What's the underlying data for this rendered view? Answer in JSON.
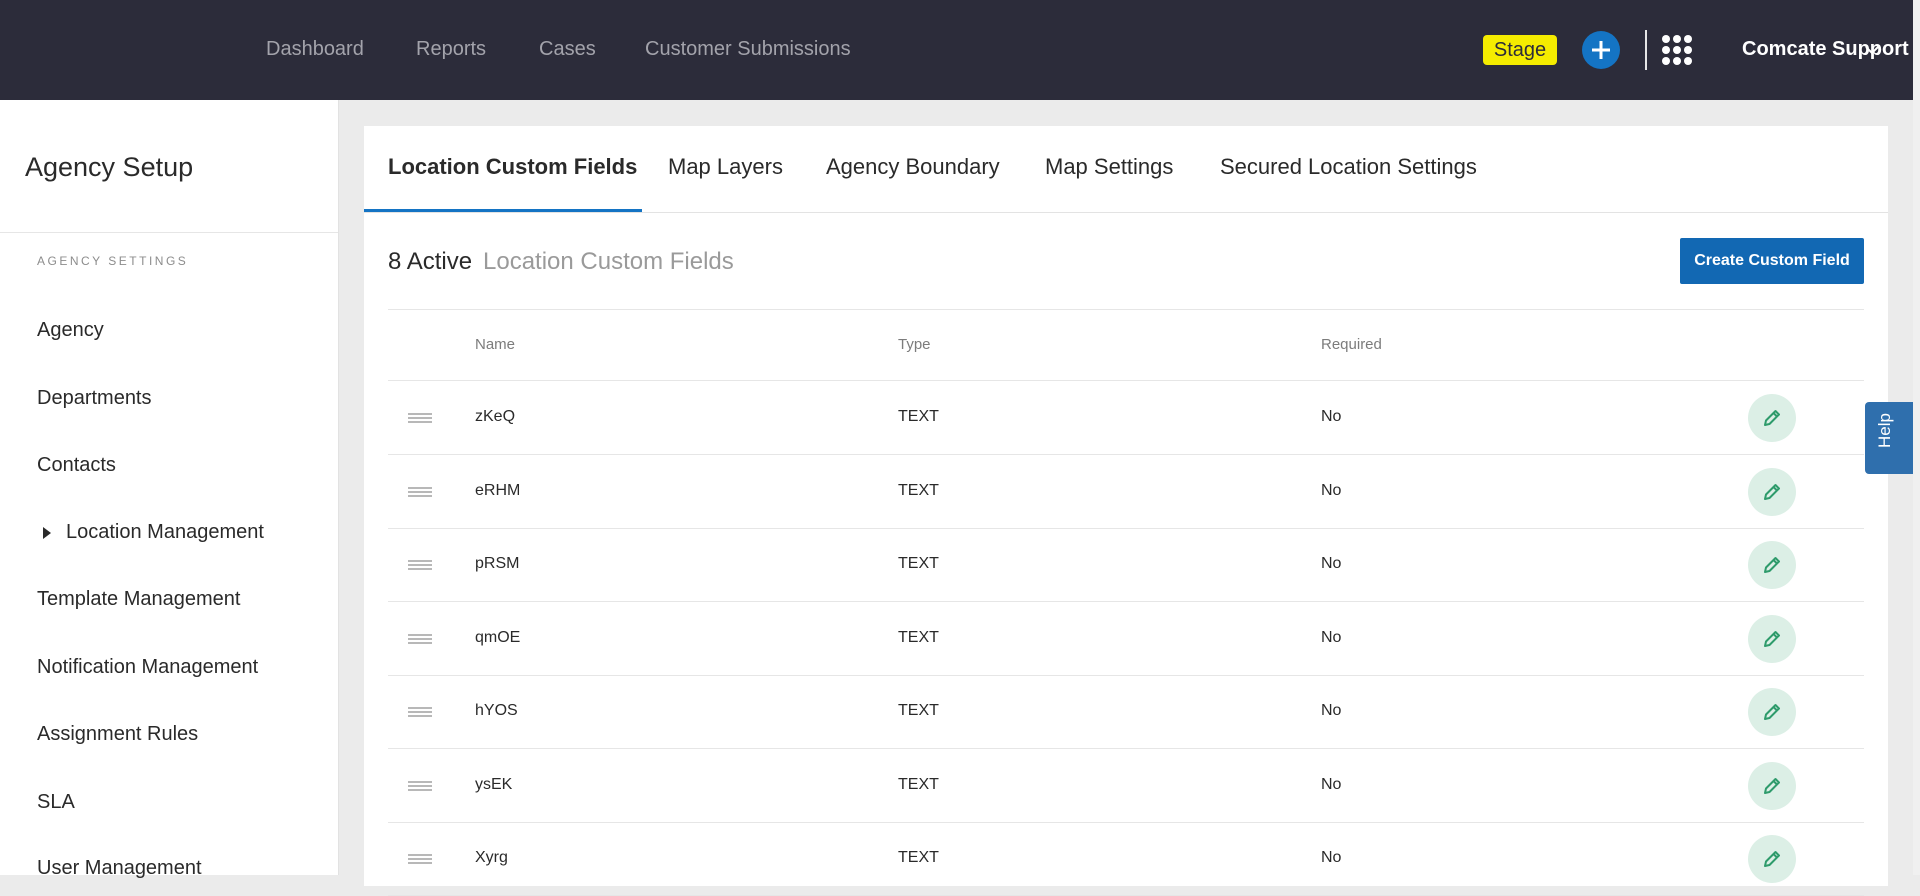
{
  "topbar": {
    "nav": [
      "Dashboard",
      "Reports",
      "Cases",
      "Customer Submissions"
    ],
    "environment_badge": "Stage",
    "add_icon": "plus-icon",
    "apps_icon": "grid-icon",
    "org_name": "Comcate Support",
    "org_chevron_icon": "chevron-down-icon"
  },
  "sidebar": {
    "title": "Agency Setup",
    "section_label": "AGENCY SETTINGS",
    "items": [
      {
        "label": "Agency"
      },
      {
        "label": "Departments"
      },
      {
        "label": "Contacts"
      },
      {
        "label": "Location Management",
        "expand_icon": "caret-right-icon"
      },
      {
        "label": "Template Management"
      },
      {
        "label": "Notification Management"
      },
      {
        "label": "Assignment Rules"
      },
      {
        "label": "SLA"
      },
      {
        "label": "User Management"
      }
    ]
  },
  "tabs": [
    "Location Custom Fields",
    "Map Layers",
    "Agency Boundary",
    "Map Settings",
    "Secured Location Settings"
  ],
  "active_tab": "Location Custom Fields",
  "header": {
    "count": "8 Active",
    "subtitle": "Location Custom Fields",
    "create_button": "Create Custom Field"
  },
  "table": {
    "columns": [
      "Name",
      "Type",
      "Required"
    ],
    "rows": [
      {
        "name": "zKeQ",
        "type": "TEXT",
        "required": "No"
      },
      {
        "name": "eRHM",
        "type": "TEXT",
        "required": "No"
      },
      {
        "name": "pRSM",
        "type": "TEXT",
        "required": "No"
      },
      {
        "name": "qmOE",
        "type": "TEXT",
        "required": "No"
      },
      {
        "name": "hYOS",
        "type": "TEXT",
        "required": "No"
      },
      {
        "name": "ysEK",
        "type": "TEXT",
        "required": "No"
      },
      {
        "name": "Xyrg",
        "type": "TEXT",
        "required": "No"
      }
    ],
    "row_icons": {
      "drag": "drag-handle-icon",
      "edit": "pencil-icon"
    }
  },
  "help": {
    "label": "Help"
  },
  "colors": {
    "topbar_bg": "#2c2c3a",
    "accent_blue": "#1474c4",
    "badge_yellow": "#f5ec00",
    "edit_bg": "#dcefe6",
    "edit_icon": "#2e9b6b",
    "help_bg": "#2f6fad"
  }
}
